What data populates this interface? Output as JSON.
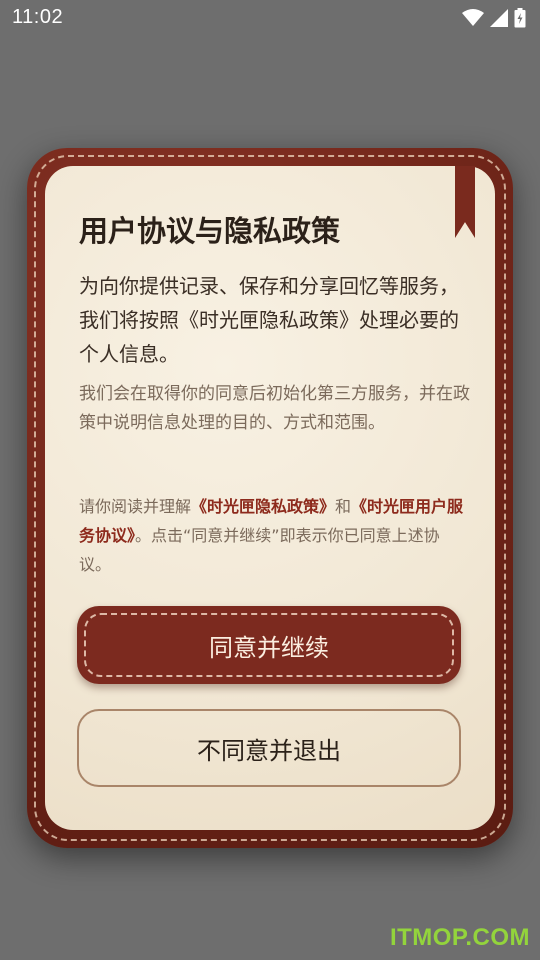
{
  "status_bar": {
    "time": "11:02",
    "icons": [
      "wifi-icon",
      "cellular-signal-icon",
      "battery-charging-icon"
    ]
  },
  "dialog": {
    "title": "用户协议与隐私政策",
    "paragraph_main": "为向你提供记录、保存和分享回忆等服务，我们将按照《时光匣隐私政策》处理必要的个人信息。",
    "paragraph_sub": "我们会在取得你的同意后初始化第三方服务，并在政策中说明信息处理的目的、方式和范围。",
    "agreement": {
      "prefix": "请你阅读并理解",
      "privacy_link": "《时光匣隐私政策》",
      "and": "和",
      "terms_link": "《时光匣用户服务协议》",
      "suffix": "。点击“同意并继续”即表示你已同意上述协议。"
    },
    "agree_button": "同意并继续",
    "decline_button": "不同意并退出"
  },
  "watermark": "ITMOP.COM",
  "colors": {
    "leather": "#7c2a1f",
    "paper": "#f3ead8",
    "link": "#8d2a1c",
    "watermark": "#93d43c"
  }
}
